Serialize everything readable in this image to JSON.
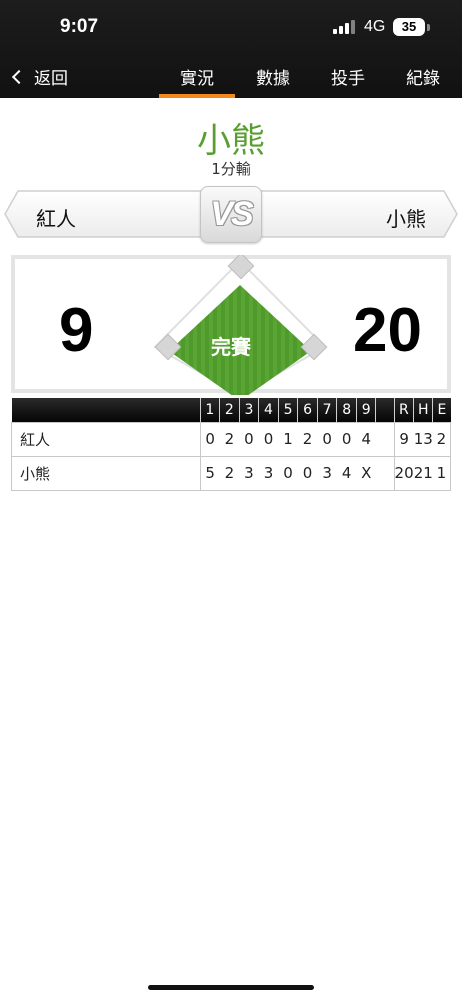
{
  "status_bar": {
    "time": "9:07",
    "network": "4G",
    "battery": "35"
  },
  "nav": {
    "back_label": "返回",
    "tabs": [
      {
        "label": "實況",
        "active": true
      },
      {
        "label": "數據",
        "active": false
      },
      {
        "label": "投手",
        "active": false
      },
      {
        "label": "紀錄",
        "active": false
      }
    ]
  },
  "game": {
    "winner": "小熊",
    "margin_text": "1分輸",
    "away_team": "紅人",
    "home_team": "小熊",
    "vs_label": "VS",
    "away_score": "9",
    "home_score": "20",
    "status": "完賽"
  },
  "linescore": {
    "headers": [
      "1",
      "2",
      "3",
      "4",
      "5",
      "6",
      "7",
      "8",
      "9",
      "",
      "R",
      "H",
      "E"
    ],
    "rows": [
      {
        "team": "紅人",
        "innings": [
          "0",
          "2",
          "0",
          "0",
          "1",
          "2",
          "0",
          "0",
          "4"
        ],
        "R": "9",
        "H": "13",
        "E": "2"
      },
      {
        "team": "小熊",
        "innings": [
          "5",
          "2",
          "3",
          "3",
          "0",
          "0",
          "3",
          "4",
          "X"
        ],
        "R": "20",
        "H": "21",
        "E": "1"
      }
    ]
  },
  "colors": {
    "accent": "#f08a1c",
    "winner": "#5a9e32",
    "field": "#4f9a2c"
  }
}
